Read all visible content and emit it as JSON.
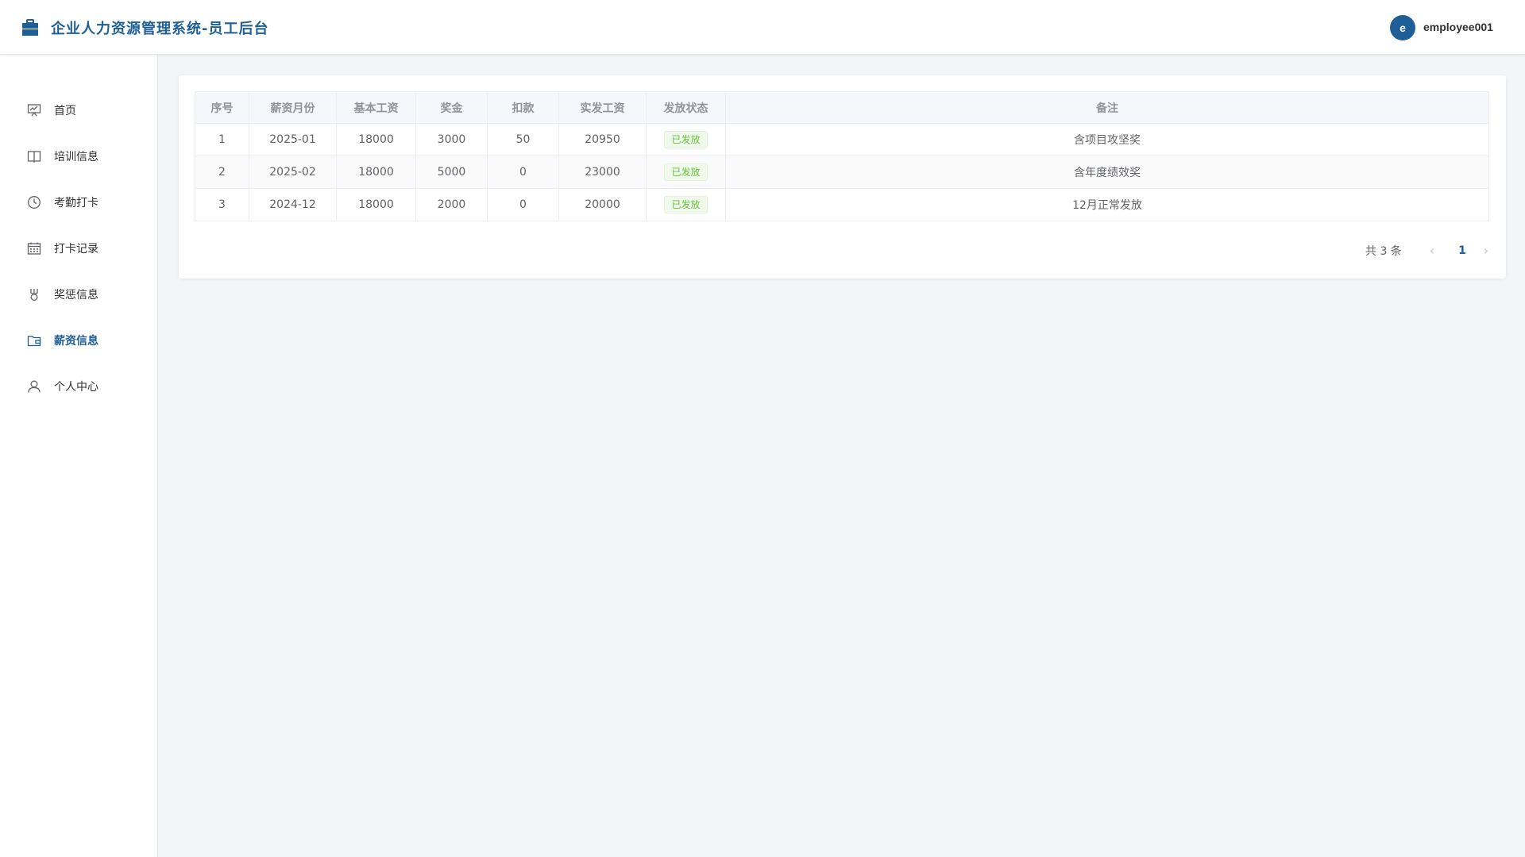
{
  "header": {
    "title": "企业人力资源管理系统-员工后台",
    "avatar_letter": "e",
    "username": "employee001",
    "brand_color": "#1f5f97"
  },
  "sidebar": {
    "items": [
      {
        "label": "首页",
        "icon": "dashboard-icon"
      },
      {
        "label": "培训信息",
        "icon": "book-icon"
      },
      {
        "label": "考勤打卡",
        "icon": "clock-icon"
      },
      {
        "label": "打卡记录",
        "icon": "calendar-icon"
      },
      {
        "label": "奖惩信息",
        "icon": "medal-icon"
      },
      {
        "label": "薪资信息",
        "icon": "wallet-icon",
        "active": true
      },
      {
        "label": "个人中心",
        "icon": "user-icon"
      }
    ]
  },
  "table": {
    "columns": [
      "序号",
      "薪资月份",
      "基本工资",
      "奖金",
      "扣款",
      "实发工资",
      "发放状态",
      "备注"
    ],
    "rows": [
      {
        "index": "1",
        "month": "2025-01",
        "base": "18000",
        "bonus": "3000",
        "deduction": "50",
        "net": "20950",
        "status": "已发放",
        "remark": "含项目攻坚奖"
      },
      {
        "index": "2",
        "month": "2025-02",
        "base": "18000",
        "bonus": "5000",
        "deduction": "0",
        "net": "23000",
        "status": "已发放",
        "remark": "含年度绩效奖"
      },
      {
        "index": "3",
        "month": "2024-12",
        "base": "18000",
        "bonus": "2000",
        "deduction": "0",
        "net": "20000",
        "status": "已发放",
        "remark": "12月正常发放"
      }
    ]
  },
  "pagination": {
    "total_text": "共 3 条",
    "current_page": "1",
    "prev_icon": "chevron-left-icon",
    "next_icon": "chevron-right-icon"
  }
}
